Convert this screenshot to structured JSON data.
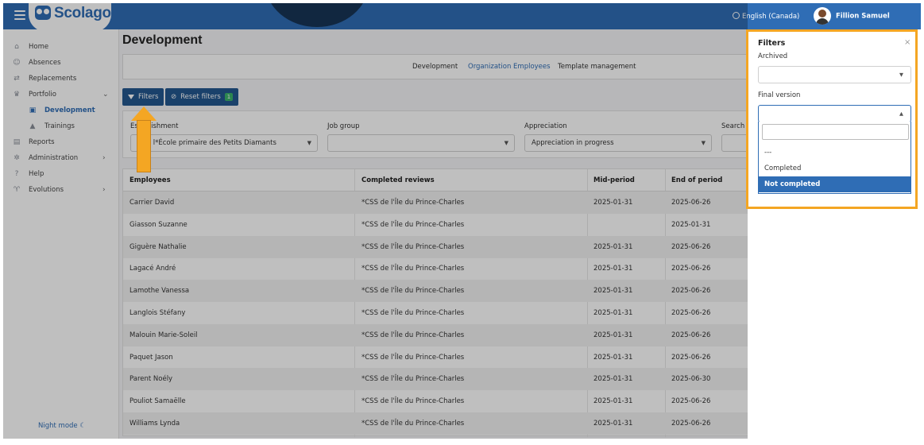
{
  "header": {
    "logo": "Scolago",
    "language": "English (Canada)",
    "user": "Fillion Samuel"
  },
  "sidebar": {
    "items": [
      {
        "label": "Home",
        "icon": "home-icon"
      },
      {
        "label": "Absences",
        "icon": "absences-icon"
      },
      {
        "label": "Replacements",
        "icon": "replacements-icon"
      },
      {
        "label": "Portfolio",
        "icon": "trophy-icon"
      },
      {
        "label": "Development",
        "icon": "development-icon"
      },
      {
        "label": "Trainings",
        "icon": "graduation-icon"
      },
      {
        "label": "Reports",
        "icon": "reports-icon"
      },
      {
        "label": "Administration",
        "icon": "gear-icon"
      },
      {
        "label": "Help",
        "icon": "help-icon"
      },
      {
        "label": "Evolutions",
        "icon": "evolutions-icon"
      }
    ],
    "night_mode": "Night mode"
  },
  "main": {
    "title": "Development",
    "tabs": [
      "Development",
      "Organization Employees",
      "Template management"
    ],
    "filters_button": "Filters",
    "reset_button": "Reset filters",
    "reset_badge": "1",
    "filters": {
      "establishment_label": "Establishment",
      "establishment_value": "B1 - l*École primaire des Petits Diamants",
      "job_group_label": "Job group",
      "appreciation_label": "Appreciation",
      "appreciation_value": "Appreciation in progress",
      "search_label": "Search b"
    },
    "table": {
      "headers": [
        "Employees",
        "Completed reviews",
        "Mid-period",
        "End of period"
      ],
      "rows": [
        [
          "Carrier David",
          "*CSS de l'Île du Prince-Charles",
          "2025-01-31",
          "2025-06-26"
        ],
        [
          "Giasson Suzanne",
          "*CSS de l'Île du Prince-Charles",
          "",
          "2025-01-31"
        ],
        [
          "Giguère Nathalie",
          "*CSS de l'Île du Prince-Charles",
          "2025-01-31",
          "2025-06-26"
        ],
        [
          "Lagacé André",
          "*CSS de l'Île du Prince-Charles",
          "2025-01-31",
          "2025-06-26"
        ],
        [
          "Lamothe Vanessa",
          "*CSS de l'Île du Prince-Charles",
          "2025-01-31",
          "2025-06-26"
        ],
        [
          "Langlois Stéfany",
          "*CSS de l'Île du Prince-Charles",
          "2025-01-31",
          "2025-06-26"
        ],
        [
          "Malouin Marie-Soleil",
          "*CSS de l'Île du Prince-Charles",
          "2025-01-31",
          "2025-06-26"
        ],
        [
          "Paquet Jason",
          "*CSS de l'Île du Prince-Charles",
          "2025-01-31",
          "2025-06-26"
        ],
        [
          "Parent Noély",
          "*CSS de l'Île du Prince-Charles",
          "2025-01-31",
          "2025-06-30"
        ],
        [
          "Pouliot Samaëlle",
          "*CSS de l'Île du Prince-Charles",
          "2025-01-31",
          "2025-06-26"
        ],
        [
          "Williams Lynda",
          "*CSS de l'Île du Prince-Charles",
          "2025-01-31",
          "2025-06-26"
        ]
      ]
    }
  },
  "panel": {
    "title": "Filters",
    "archived_label": "Archived",
    "archived_value": "",
    "final_version_label": "Final version",
    "options": [
      "---",
      "Completed",
      "Not completed"
    ],
    "highlighted_option": "Not completed"
  },
  "colors": {
    "brand": "#2f6db5",
    "button": "#23578f",
    "highlight": "#f4a623",
    "badge": "#3bb36b"
  }
}
